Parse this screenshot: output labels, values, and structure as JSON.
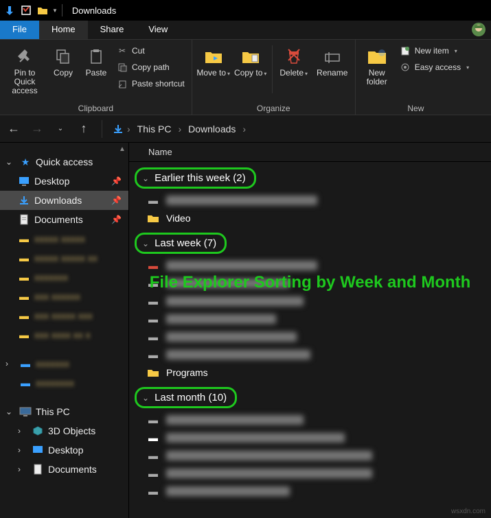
{
  "titlebar": {
    "title": "Downloads"
  },
  "ribbon_tabs": {
    "file": "File",
    "home": "Home",
    "share": "Share",
    "view": "View"
  },
  "ribbon": {
    "clipboard": {
      "label": "Clipboard",
      "pin": "Pin to Quick access",
      "copy": "Copy",
      "paste": "Paste",
      "cut": "Cut",
      "copy_path": "Copy path",
      "paste_shortcut": "Paste shortcut"
    },
    "organize": {
      "label": "Organize",
      "move": "Move to",
      "copy": "Copy to",
      "delete": "Delete",
      "rename": "Rename"
    },
    "new": {
      "label": "New",
      "folder": "New folder",
      "new_item": "New item",
      "easy_access": "Easy access"
    }
  },
  "breadcrumb": {
    "seg1": "This PC",
    "seg2": "Downloads"
  },
  "sidebar": {
    "quick_access": "Quick access",
    "desktop": "Desktop",
    "downloads": "Downloads",
    "documents": "Documents",
    "this_pc": "This PC",
    "objects3d": "3D Objects",
    "pc_desktop": "Desktop",
    "pc_documents": "Documents"
  },
  "content": {
    "column": "Name",
    "group1": "Earlier this week (2)",
    "group2": "Last week (7)",
    "group3": "Last month (10)",
    "video": "Video",
    "programs": "Programs"
  },
  "caption": "File Explorer Sorting by Week and Month",
  "watermark": "wsxdn.com"
}
